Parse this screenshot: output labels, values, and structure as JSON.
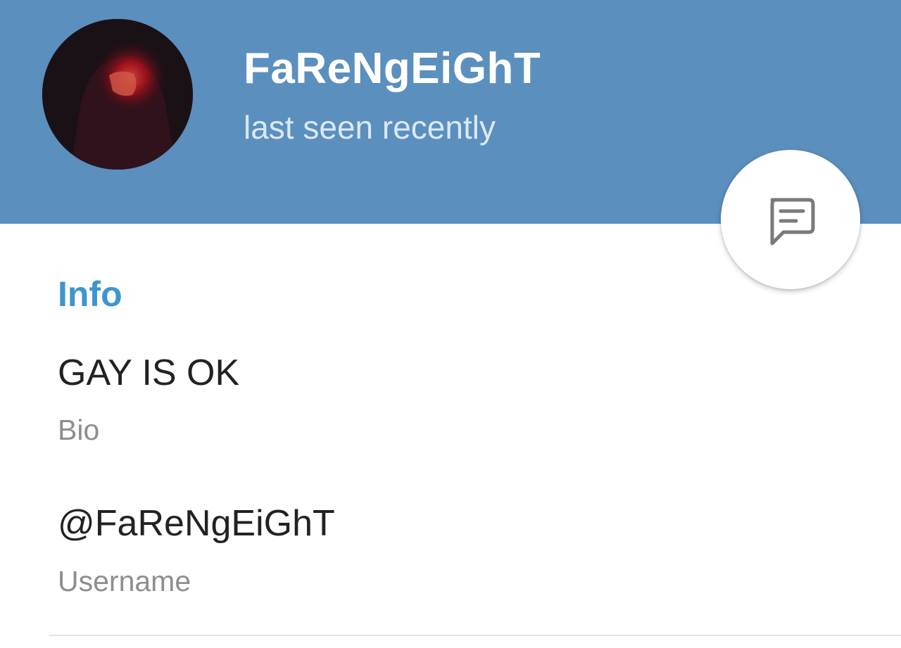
{
  "profile": {
    "name": "FaReNgEiGhT",
    "status": "last seen recently"
  },
  "info": {
    "section_title": "Info",
    "bio": {
      "value": "GAY IS OK",
      "label": "Bio"
    },
    "username": {
      "value": "@FaReNgEiGhT",
      "label": "Username"
    }
  },
  "icons": {
    "fab": "message-icon"
  },
  "colors": {
    "header_bg": "#5b8fbe",
    "accent": "#3d95cf",
    "primary_text": "#222222",
    "secondary_text": "#8e8e8e"
  }
}
